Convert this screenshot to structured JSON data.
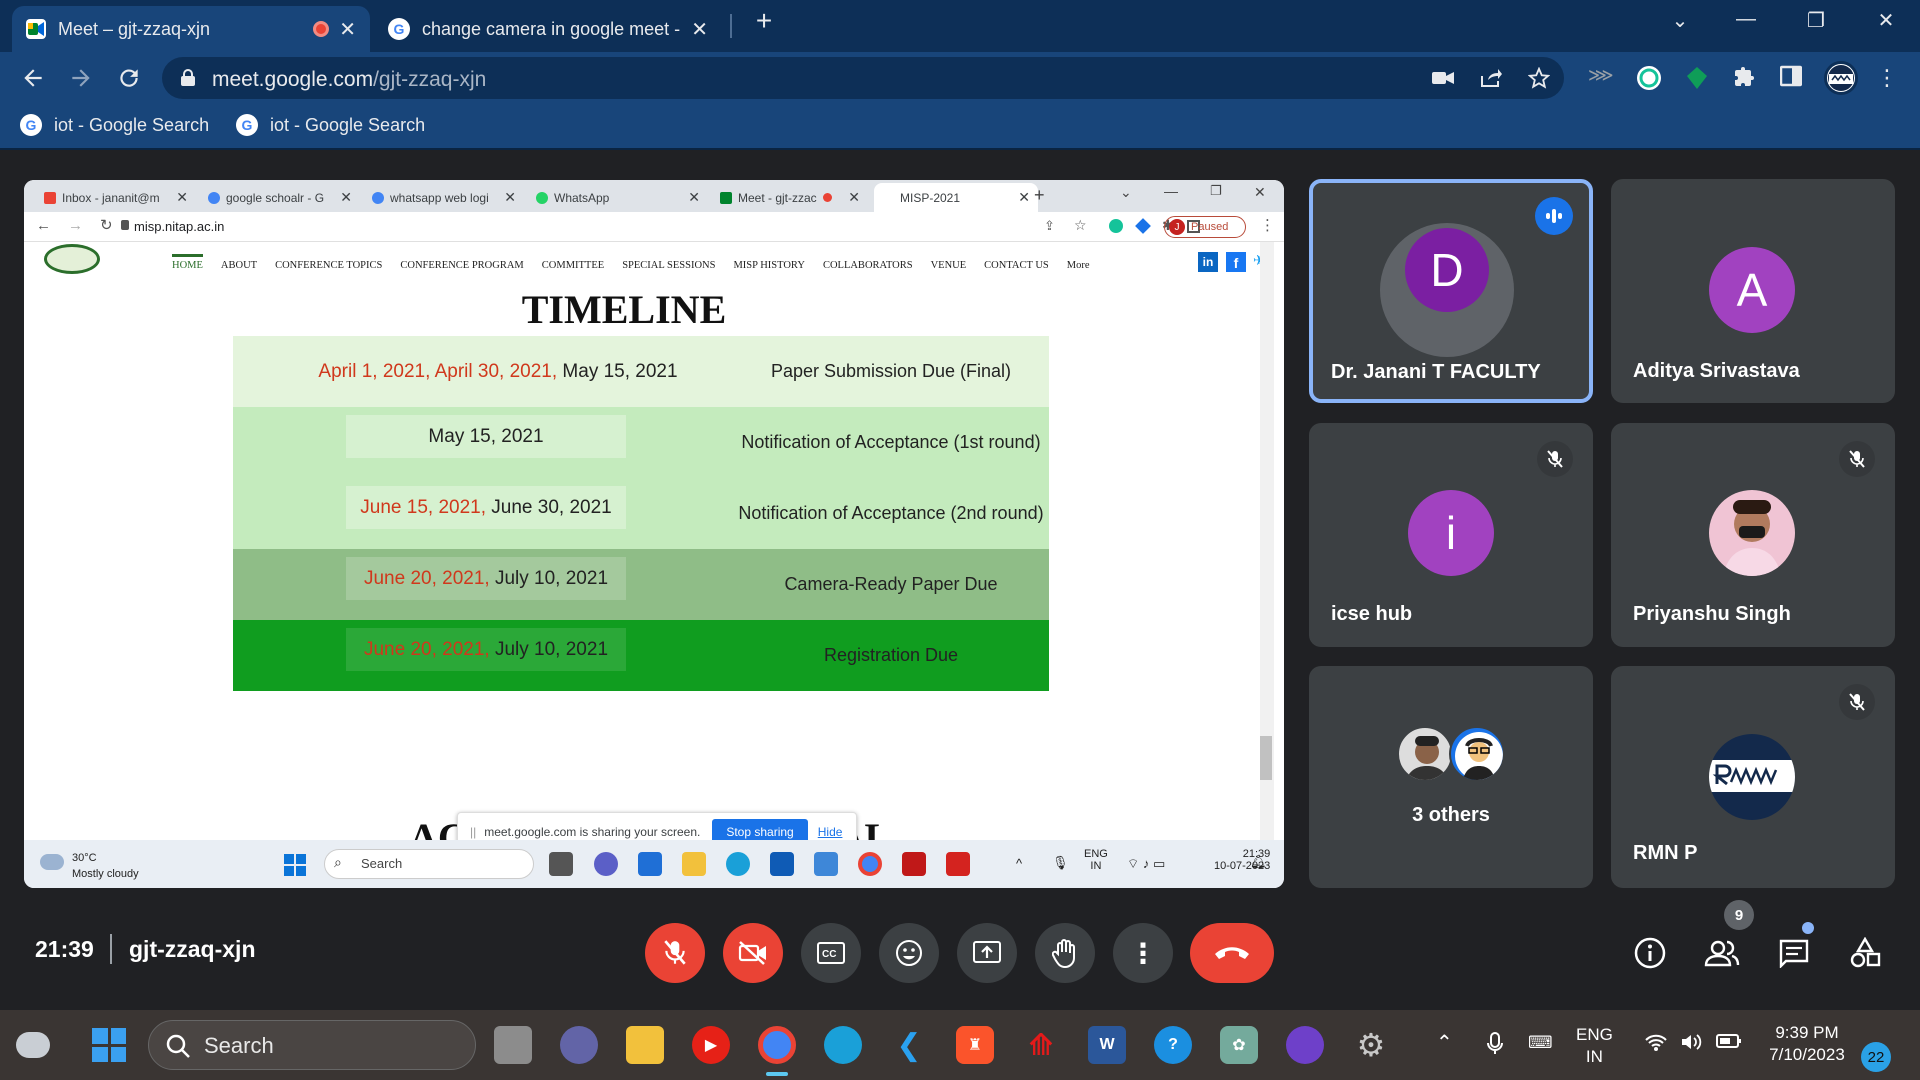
{
  "browser": {
    "tabs": [
      {
        "title": "Meet – gjt-zzaq-xjn",
        "active": true
      },
      {
        "title": "change camera in google meet -",
        "active": false
      }
    ],
    "url_host": "meet.google.com",
    "url_path": "/gjt-zzaq-xjn",
    "bookmarks": [
      "iot - Google Search",
      "iot - Google Search"
    ]
  },
  "shared_screen": {
    "tabs": [
      "Inbox - jananit@m",
      "google schoalr - G",
      "whatsapp web logi",
      "WhatsApp",
      "Meet - gjt-zzac",
      "MISP-2021"
    ],
    "url": "misp.nitap.ac.in",
    "profile_initial": "J",
    "profile_status": "Paused",
    "site_nav": [
      "HOME",
      "ABOUT",
      "CONFERENCE TOPICS",
      "CONFERENCE PROGRAM",
      "COMMITTEE",
      "SPECIAL SESSIONS",
      "MISP HISTORY",
      "COLLABORATORS",
      "VENUE",
      "CONTACT US",
      "More"
    ],
    "page_title": "TIMELINE",
    "timeline": [
      {
        "dates_red": "April 1, 2021, April 30, 2021,",
        "dates_black": "May 15, 2021",
        "event": "Paper Submission Due (Final)",
        "bg": "#e4f4dc",
        "box": "transparent",
        "box_wide": true
      },
      {
        "dates_red": "",
        "dates_black": "May 15, 2021",
        "event": "Notification of Acceptance (1st round)",
        "bg": "#c4ebbd",
        "box": "#d6f1d0",
        "box_wide": false
      },
      {
        "dates_red": "June 15, 2021,",
        "dates_black": "June 30, 2021",
        "event": "Notification of Acceptance (2nd round)",
        "bg": "#c4ebbd",
        "box": "#d6f1d0",
        "box_wide": false
      },
      {
        "dates_red": "June 20, 2021,",
        "dates_black": "July 10, 2021",
        "event": "Camera-Ready Paper Due",
        "bg": "#8fbd87",
        "box": "#a4c99d",
        "box_wide": false
      },
      {
        "dates_red": "June 20, 2021,",
        "dates_black": "July 10, 2021",
        "event": "Registration Due",
        "bg": "#109d1f",
        "box": "#2ba838",
        "box_wide": false
      }
    ],
    "bottom_heading_left": "AC",
    "bottom_heading_right": "CAL",
    "share_notice": "meet.google.com is sharing your screen.",
    "share_stop": "Stop sharing",
    "share_hide": "Hide",
    "taskbar": {
      "weather_temp": "30°C",
      "weather_desc": "Mostly cloudy",
      "search": "Search",
      "lang1": "ENG",
      "lang2": "IN",
      "time": "21:39",
      "date": "10-07-2023"
    }
  },
  "participants": [
    {
      "name": "Dr. Janani T FACULTY",
      "initial": "D",
      "color": "#7b1fa2",
      "speaking": true
    },
    {
      "name": "Aditya Srivastava",
      "initial": "A",
      "color": "#a142c0",
      "speaking": false
    },
    {
      "name": "icse hub",
      "initial": "i",
      "color": "#a142c0",
      "muted": true
    },
    {
      "name": "Priyanshu Singh",
      "initial": "",
      "muted": true
    },
    {
      "name": "3 others",
      "count_avatars": 2
    },
    {
      "name": "RMN P",
      "initial": "",
      "muted": true
    }
  ],
  "meeting": {
    "time": "21:39",
    "code": "gjt-zzaq-xjn",
    "people_count": "9"
  },
  "os_taskbar": {
    "search": "Search",
    "lang1": "ENG",
    "lang2": "IN",
    "time": "9:39 PM",
    "date": "7/10/2023",
    "notifications": "22"
  },
  "colors": {
    "chrome_tab_bar": "#0d2f57",
    "chrome_toolbar": "#18457a",
    "meet_bg": "#202124",
    "tile_bg": "#3c4043",
    "danger": "#ea4335",
    "accent": "#8ab4f8"
  }
}
